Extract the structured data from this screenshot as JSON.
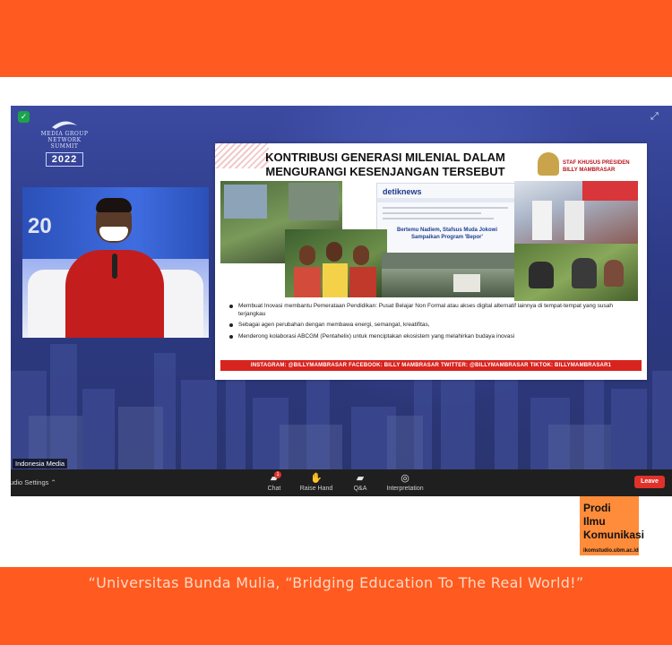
{
  "tagline": "“Universitas Bunda Mulia, “Bridging Education To The Real World!”",
  "event_logo": {
    "org_line1": "MEDIA GROUP",
    "org_line2": "NETWORK",
    "org_line3": "SUMMIT",
    "year": "2022"
  },
  "slide": {
    "title_line1": "KONTRIBUSI GENERASI MILENIAL DALAM",
    "title_line2": "MENGURANGI KESENJANGAN TERSEBUT",
    "staff_line1": "STAF KHUSUS PRESIDEN",
    "staff_line2": "BILLY MAMBRASAR",
    "news_brand": "detiknews",
    "news_headline": "Bertemu Nadiem, Stafsus Muda Jokowi Sampaikan Program 'Bepor'",
    "bullets": [
      "Membuat Inovasi membantu Pemerataan Pendidikan: Pusat Belajar Non Formal atau akses digital alternatif lainnya di tempat-tempat yang susah terjangkau",
      "Sebagai agen perubahan dengan membawa energi, semangat, kreatifitas,",
      "Menderong kolaborasi ABCGM (Pentahelix) untuk menciptakan ekosistem yang melahirkan budaya inovasi"
    ],
    "social_bar": "INSTAGRAM: @BILLYMAMBRASAR  FACEBOOK: BILLY MAMBRASAR  TWITTER: @BILLYMAMBRASAR  TIKTOK: BILLYMAMBRASAR1"
  },
  "speaker": {
    "screen_numbers": "20"
  },
  "participant_name": "Indonesia Media",
  "toolbar": {
    "audio_settings": "Audio Settings ⌃",
    "chat": "Chat",
    "chat_badge": "1",
    "raise_hand": "Raise Hand",
    "qa": "Q&A",
    "interpretation": "Interpretation",
    "leave": "Leave"
  },
  "prodi": {
    "line1": "Prodi",
    "line2": "Ilmu",
    "line3": "Komunikasi",
    "url": "ikomstudio.ubm.ac.id"
  },
  "colors": {
    "brand_orange": "#ff5a1f",
    "accent_orange": "#ff8c3a",
    "leave_red": "#e0312b",
    "stage_blue": "#2d3a86"
  },
  "icons": {
    "security": "shield-icon",
    "fullscreen": "expand-icon",
    "chat": "chat-bubble-icon",
    "raise_hand": "hand-icon",
    "qa": "qa-bubbles-icon",
    "interpretation": "globe-icon"
  }
}
